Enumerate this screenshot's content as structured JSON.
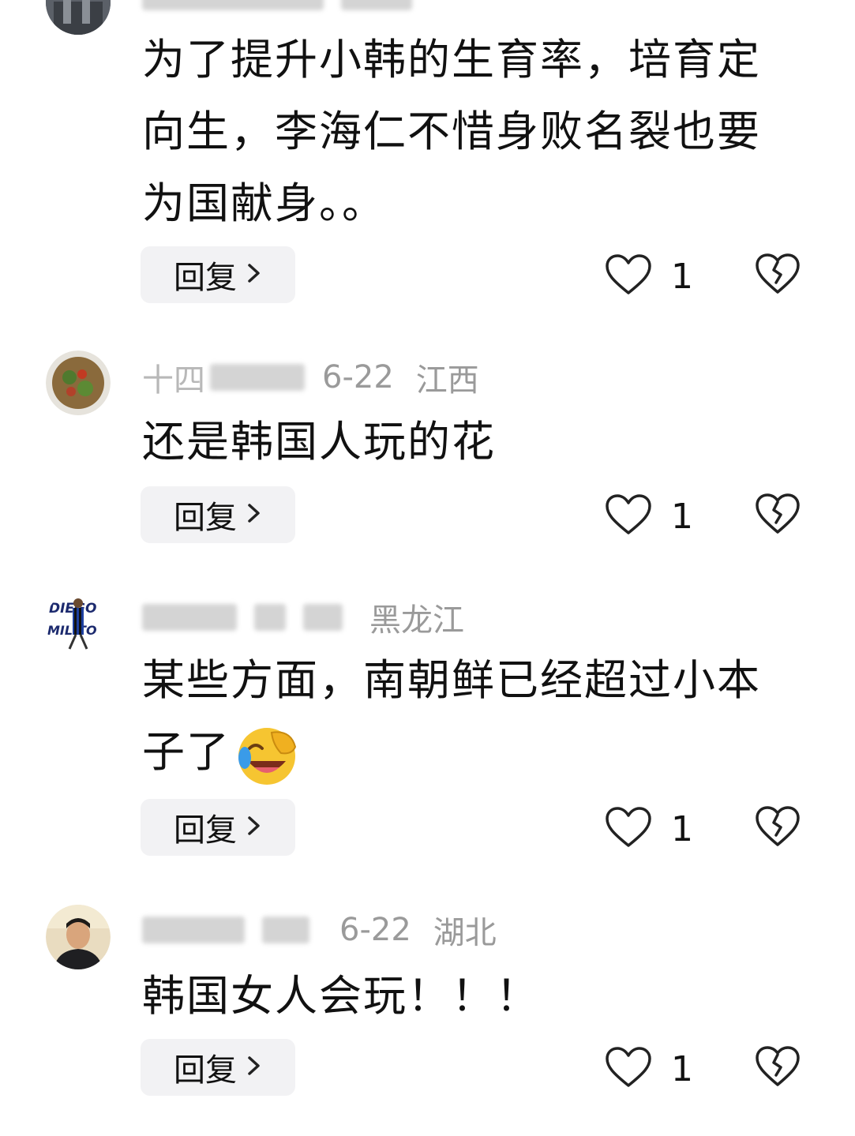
{
  "comments": [
    {
      "author": "",
      "date": "",
      "region": "",
      "text": "为了提升小韩的生育率，培育定向生，李海仁不惜身败名裂也要为国献身。。",
      "reply_label": "回复",
      "like_count": "1"
    },
    {
      "author": "十四",
      "date": "6-22",
      "region": "江西",
      "text": "还是韩国人玩的花",
      "reply_label": "回复",
      "like_count": "1"
    },
    {
      "author": "",
      "date": "",
      "region": "黑龙江",
      "avatar_text": "DIEGO MILITO",
      "text": "某些方面，南朝鲜已经超过小本子了",
      "emoji": "laughing-crying-emoji",
      "reply_label": "回复",
      "like_count": "1"
    },
    {
      "author": "",
      "date": "6-22",
      "region": "湖北",
      "text": "韩国女人会玩！！！",
      "reply_label": "回复",
      "like_count": "1"
    }
  ],
  "icons": {
    "like": "heart-outline-icon",
    "dislike": "broken-heart-icon",
    "chevron": "chevron-right-icon"
  },
  "colors": {
    "reply_bg": "#f2f2f4",
    "meta_text": "#9a9a9a",
    "icon_stroke": "#222222"
  }
}
